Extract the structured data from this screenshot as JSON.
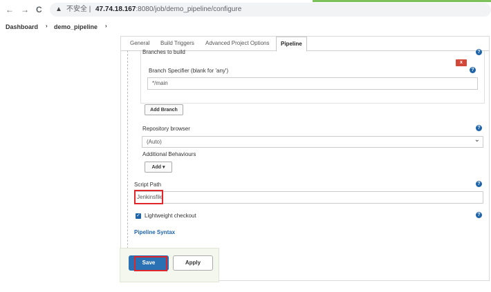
{
  "browser": {
    "back_icon": "←",
    "forward_icon": "→",
    "reload_icon": "C",
    "warning_icon": "▲",
    "security_label": "不安全 |",
    "url_host": "47.74.18.167",
    "url_rest": ":8080/job/demo_pipeline/configure"
  },
  "breadcrumb": {
    "items": [
      "Dashboard",
      "demo_pipeline"
    ],
    "separator": "›"
  },
  "tabs": [
    "General",
    "Build Triggers",
    "Advanced Project Options",
    "Pipeline"
  ],
  "form": {
    "branches_label": "Branches to build",
    "remove_label": "x",
    "branch_specifier_label": "Branch Specifier (blank for 'any')",
    "branch_specifier_value": "*/main",
    "add_branch_label": "Add Branch",
    "repo_browser_label": "Repository browser",
    "repo_browser_value": "(Auto)",
    "additional_behaviours_label": "Additional Behaviours",
    "add_label": "Add ▾",
    "script_path_label": "Script Path",
    "script_path_value": "Jenkinsfile",
    "lightweight_checkout_label": "Lightweight checkout",
    "pipeline_syntax_label": "Pipeline Syntax",
    "help_icon": "?",
    "check_icon": "✓",
    "dropdown_icon": "⌄"
  },
  "actions": {
    "save_label": "Save",
    "apply_label": "Apply"
  },
  "colors": {
    "primary": "#2a71b3",
    "danger": "#d24939",
    "highlight": "#e0262a"
  }
}
